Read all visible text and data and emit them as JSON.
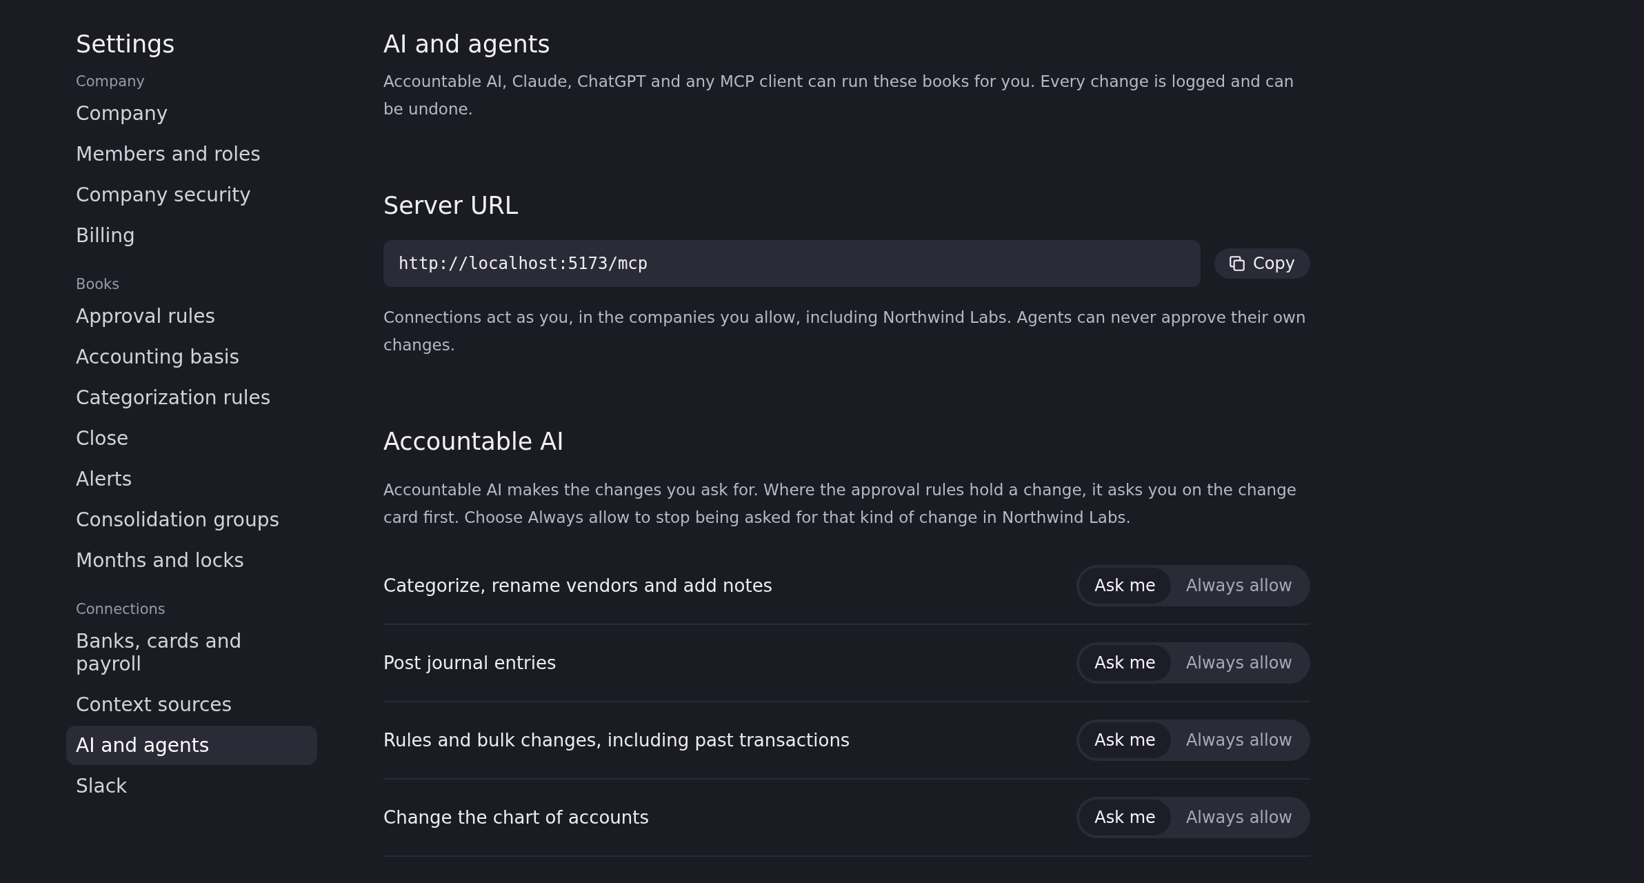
{
  "sidebar": {
    "title": "Settings",
    "sections": [
      {
        "heading": "Company",
        "items": [
          {
            "label": "Company",
            "selected": false
          },
          {
            "label": "Members and roles",
            "selected": false
          },
          {
            "label": "Company security",
            "selected": false
          },
          {
            "label": "Billing",
            "selected": false
          }
        ]
      },
      {
        "heading": "Books",
        "items": [
          {
            "label": "Approval rules",
            "selected": false
          },
          {
            "label": "Accounting basis",
            "selected": false
          },
          {
            "label": "Categorization rules",
            "selected": false
          },
          {
            "label": "Close",
            "selected": false
          },
          {
            "label": "Alerts",
            "selected": false
          },
          {
            "label": "Consolidation groups",
            "selected": false
          },
          {
            "label": "Months and locks",
            "selected": false
          }
        ]
      },
      {
        "heading": "Connections",
        "items": [
          {
            "label": "Banks, cards and payroll",
            "selected": false
          },
          {
            "label": "Context sources",
            "selected": false
          },
          {
            "label": "AI and agents",
            "selected": true
          },
          {
            "label": "Slack",
            "selected": false
          }
        ]
      }
    ]
  },
  "page": {
    "title": "AI and agents",
    "description": "Accountable AI, Claude, ChatGPT and any MCP client can run these books for you. Every change is logged and can be undone."
  },
  "server_url": {
    "heading": "Server URL",
    "value": "http://localhost:5173/mcp",
    "copy_button": "Copy",
    "note": "Connections act as you, in the companies you allow, including Northwind Labs. Agents can never approve their own changes."
  },
  "accountable_ai": {
    "heading": "Accountable AI",
    "description": "Accountable AI makes the changes you ask for. Where the approval rules hold a change, it asks you on the change card first. Choose Always allow to stop being asked for that kind of change in Northwind Labs.",
    "permissions": [
      {
        "label": "Categorize, rename vendors and add notes",
        "options": [
          {
            "label": "Ask me",
            "selected": true
          },
          {
            "label": "Always allow",
            "selected": false
          }
        ]
      },
      {
        "label": "Post journal entries",
        "options": [
          {
            "label": "Ask me",
            "selected": true
          },
          {
            "label": "Always allow",
            "selected": false
          }
        ]
      },
      {
        "label": "Rules and bulk changes, including past transactions",
        "options": [
          {
            "label": "Ask me",
            "selected": true
          },
          {
            "label": "Always allow",
            "selected": false
          }
        ]
      },
      {
        "label": "Change the chart of accounts",
        "options": [
          {
            "label": "Ask me",
            "selected": true
          },
          {
            "label": "Always allow",
            "selected": false
          }
        ]
      }
    ]
  }
}
